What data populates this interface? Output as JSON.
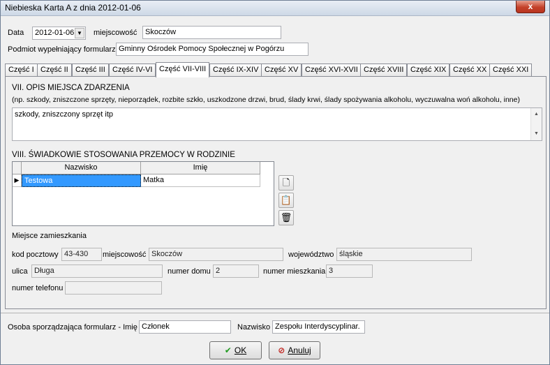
{
  "window": {
    "title": "Niebieska Karta A z dnia 2012-01-06",
    "close_glyph": "x"
  },
  "header": {
    "data_label": "Data",
    "data_value": "2012-01-06",
    "miejscowosc_label": "miejscowość",
    "miejscowosc_value": "Skoczów",
    "podmiot_label": "Podmiot wypełniający formularz",
    "podmiot_value": "Gminny Ośrodek Pomocy Społecznej w Pogórzu"
  },
  "tabs": [
    "Część I",
    "Część II",
    "Część III",
    "Część IV-VI",
    "Część VII-VIII",
    "Część IX-XIV",
    "Część XV",
    "Część XVI-XVII",
    "Część XVIII",
    "Część XIX",
    "Część XX",
    "Część XXI"
  ],
  "active_tab": "Część VII-VIII",
  "section7": {
    "title": "VII. OPIS MIEJSCA ZDARZENIA",
    "hint": "(np. szkody, zniszczone sprzęty, nieporządek, rozbite szkło, uszkodzone drzwi, brud, ślady krwi, ślady spożywania alkoholu, wyczuwalna woń alkoholu, inne)",
    "text": "szkody, zniszczony sprzęt itp"
  },
  "section8": {
    "title": "VIII. ŚWIADKOWIE STOSOWANIA PRZEMOCY W RODZINIE",
    "columns": [
      "Nazwisko",
      "Imię"
    ],
    "rows": [
      {
        "nazwisko": "Testowa",
        "imie": "Matka"
      }
    ]
  },
  "address": {
    "heading": "Miejsce zamieszkania",
    "kod_label": "kod pocztowy",
    "kod_value": "43-430",
    "miejscowosc_label": "miejscowość",
    "miejscowosc_value": "Skoczów",
    "woj_label": "województwo",
    "woj_value": "śląskie",
    "ulica_label": "ulica",
    "ulica_value": "Długa",
    "dom_label": "numer domu",
    "dom_value": "2",
    "mieszk_label": "numer mieszkania",
    "mieszk_value": "3",
    "tel_label": "numer telefonu",
    "tel_value": ""
  },
  "footer": {
    "imie_label": "Osoba sporządzająca formularz - Imię",
    "imie_value": "Członek",
    "nazwisko_label": "Nazwisko",
    "nazwisko_value": "Zespołu Interdyscyplinar.",
    "ok_label": "OK",
    "cancel_label": "Anuluj"
  }
}
